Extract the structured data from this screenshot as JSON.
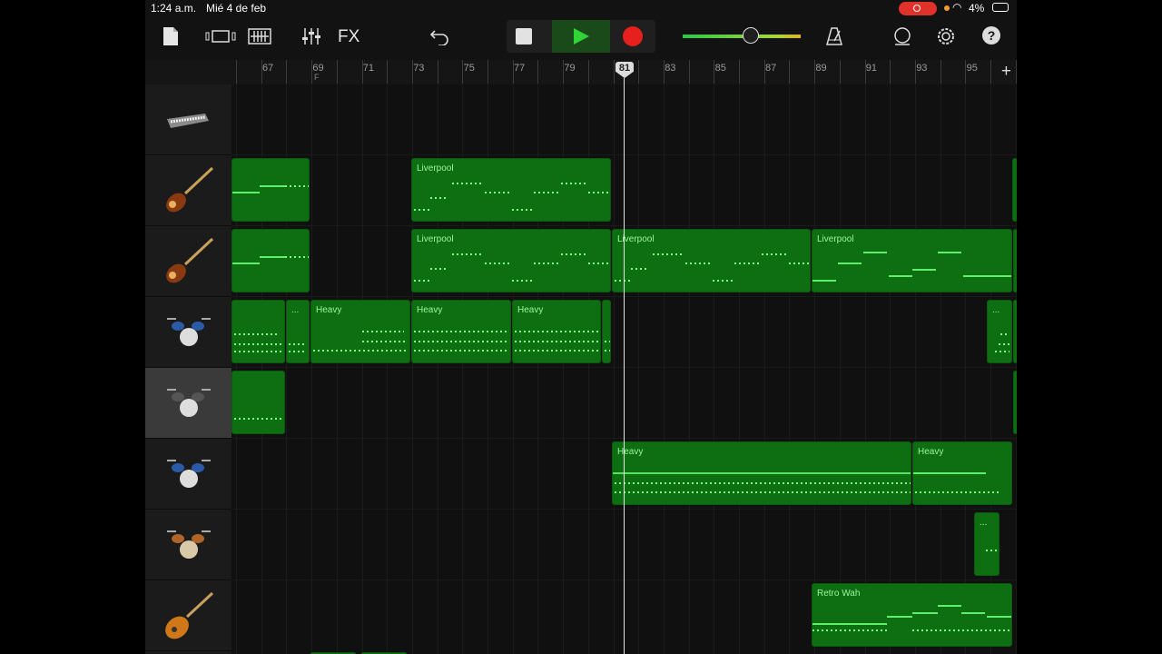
{
  "status_bar": {
    "time": "1:24 a.m.",
    "date": "Mié 4 de feb",
    "battery": "4%"
  },
  "toolbar": {
    "fx_label": "FX",
    "help_label": "?"
  },
  "ruler": {
    "bars": [
      "67",
      "69",
      "71",
      "73",
      "75",
      "77",
      "79",
      "81",
      "83",
      "85",
      "87",
      "89",
      "91",
      "93",
      "95"
    ],
    "section_marker": "F",
    "playhead_bar": "81",
    "add_label": "+"
  },
  "tracks": [
    {
      "name": "keyboard-track",
      "instrument": "keyboard-icon"
    },
    {
      "name": "bass-track-1",
      "instrument": "bass-guitar-icon"
    },
    {
      "name": "bass-track-2",
      "instrument": "bass-guitar-icon"
    },
    {
      "name": "drums-track-1",
      "instrument": "drum-kit-icon"
    },
    {
      "name": "drums-track-2",
      "instrument": "drum-kit-icon",
      "selected": true
    },
    {
      "name": "drums-track-3",
      "instrument": "drum-kit-icon"
    },
    {
      "name": "drums-track-4",
      "instrument": "drum-kit-icon"
    },
    {
      "name": "guitar-track",
      "instrument": "electric-guitar-icon"
    }
  ],
  "regions": {
    "liverpool": "Liverpool",
    "heavy": "Heavy",
    "retro_wah": "Retro Wah",
    "ellipsis": "..."
  },
  "colors": {
    "region_green": "#0e6e12",
    "note_green": "#5ff06a",
    "record_red": "#e5201d",
    "play_green": "#30d338"
  }
}
